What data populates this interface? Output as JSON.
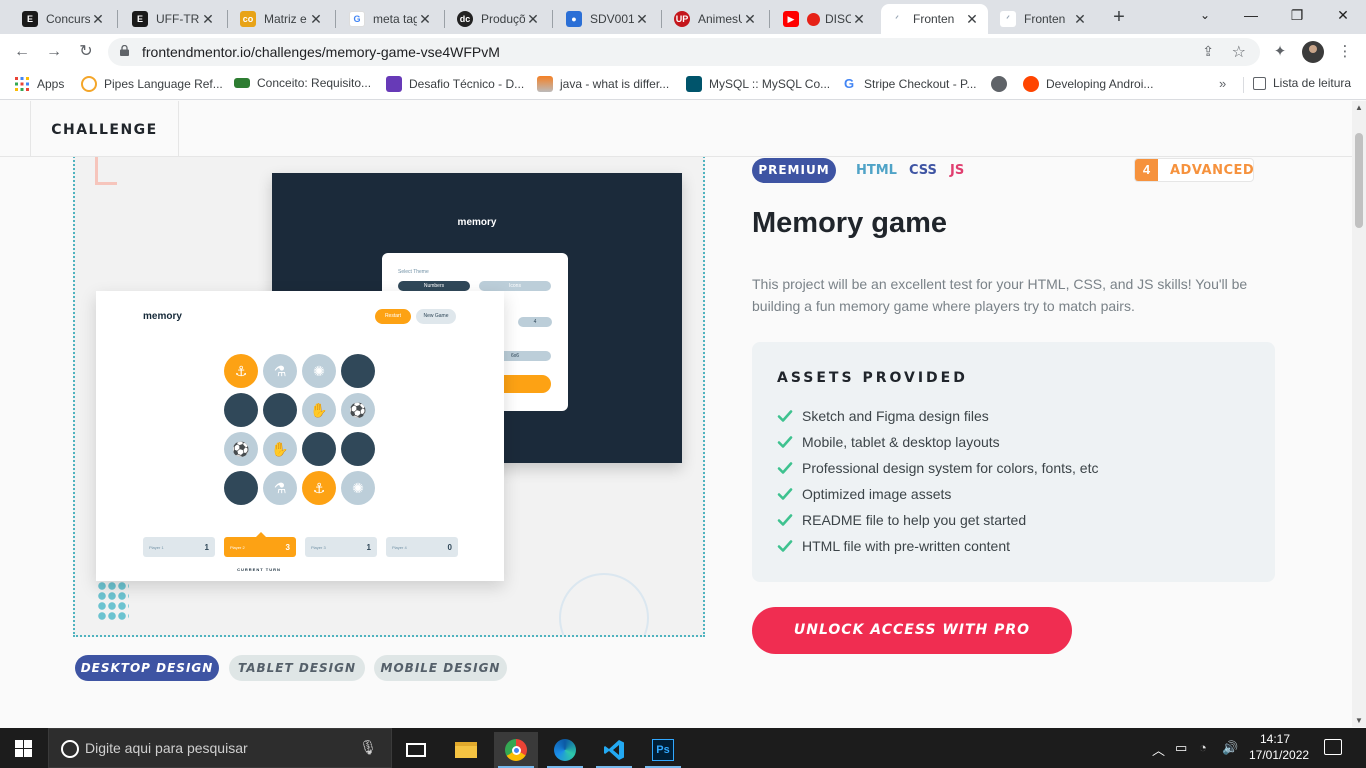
{
  "browser": {
    "tabs": [
      {
        "title": "Concurs",
        "icon": "e-icon",
        "color": "#1a1a1a"
      },
      {
        "title": "UFF-TRN",
        "icon": "e-icon",
        "color": "#1a1a1a"
      },
      {
        "title": "Matriz e",
        "icon": "colab-icon",
        "color": "#e8a317"
      },
      {
        "title": "meta tag",
        "icon": "google-icon",
        "color": "#4285f4"
      },
      {
        "title": "Produçõ",
        "icon": "dc-icon",
        "color": "#222222"
      },
      {
        "title": "SDV001",
        "icon": "user-icon",
        "color": "#2b6fd6"
      },
      {
        "title": "AnimesU",
        "icon": "up-icon",
        "color": "#c4161c"
      },
      {
        "title": "DISC",
        "icon": "youtube-icon",
        "color": "#ff0000"
      },
      {
        "title": "Fronten",
        "icon": "frontendmentor-icon",
        "color": "#9aa7b6"
      },
      {
        "title": "Fronten",
        "icon": "frontendmentor-icon",
        "color": "#9aa7b6"
      }
    ],
    "url": "frontendmentor.io/challenges/memory-game-vse4WFPvM",
    "bookmarks": [
      {
        "label": "Apps",
        "icon": "apps-grid-icon"
      },
      {
        "label": "Pipes Language Ref...",
        "icon": "pipes-icon"
      },
      {
        "label": "Conceito: Requisito...",
        "icon": "ifrn-icon"
      },
      {
        "label": "Desafio Técnico - D...",
        "icon": "forms-icon"
      },
      {
        "label": "java - what is differ...",
        "icon": "stackoverflow-icon"
      },
      {
        "label": "MySQL :: MySQL Co...",
        "icon": "mysql-icon"
      },
      {
        "label": "Stripe Checkout - P...",
        "icon": "google-icon"
      },
      {
        "label": "",
        "icon": "globe-icon"
      },
      {
        "label": "Developing Androi...",
        "icon": "reddit-icon"
      }
    ],
    "more": "»",
    "reading_list": "Lista de leitura"
  },
  "site": {
    "nav_tab": "CHALLENGE",
    "preview": {
      "back_logo": "memory",
      "select_theme": "Select Theme",
      "numbers": "Numbers",
      "icons": "Icons",
      "grid_4": "4",
      "grid_6": "6x6",
      "front_logo": "memory",
      "restart": "Restart",
      "new_game": "New Game",
      "players": [
        {
          "label": "Player 1",
          "score": "1"
        },
        {
          "label": "Player 2",
          "score": "3"
        },
        {
          "label": "Player 3",
          "score": "1"
        },
        {
          "label": "Player 4",
          "score": "0"
        }
      ],
      "current_turn": "CURRENT TURN",
      "board": [
        [
          "match",
          "open",
          "open",
          "closed"
        ],
        [
          "closed",
          "closed",
          "open",
          "open"
        ],
        [
          "open",
          "open",
          "closed",
          "closed"
        ],
        [
          "closed",
          "open",
          "match",
          "open"
        ]
      ],
      "board_icons": [
        [
          "⚓",
          "⚗",
          "✺",
          ""
        ],
        [
          "",
          "",
          "✋",
          "⚽"
        ],
        [
          "⚽",
          "✋",
          "",
          ""
        ],
        [
          "",
          "⚗",
          "⚓",
          "✺"
        ]
      ]
    },
    "design_tabs": [
      "DESKTOP DESIGN",
      "TABLET DESIGN",
      "MOBILE DESIGN"
    ],
    "badge": "PREMIUM",
    "languages": [
      {
        "label": "HTML",
        "color": "#4fa3c7"
      },
      {
        "label": "CSS",
        "color": "#3e54a3"
      },
      {
        "label": "JS",
        "color": "#e03e6f"
      }
    ],
    "level_number": "4",
    "level_label": "ADVANCED",
    "title": "Memory game",
    "description": "This project will be an excellent test for your HTML, CSS, and JS skills! You'll be building a fun memory game where players try to match pairs.",
    "assets_heading": "ASSETS PROVIDED",
    "assets": [
      "Sketch and Figma design files",
      "Mobile, tablet & desktop layouts",
      "Professional design system for colors, fonts, etc",
      "Optimized image assets",
      "README file to help you get started",
      "HTML file with pre-written content"
    ],
    "unlock": "UNLOCK ACCESS WITH PRO"
  },
  "taskbar": {
    "search_placeholder": "Digite aqui para pesquisar",
    "time": "14:17",
    "date": "17/01/2022",
    "apps": [
      "task-view-icon",
      "file-explorer-icon",
      "chrome-icon",
      "edge-icon",
      "vscode-icon",
      "photoshop-icon"
    ]
  }
}
